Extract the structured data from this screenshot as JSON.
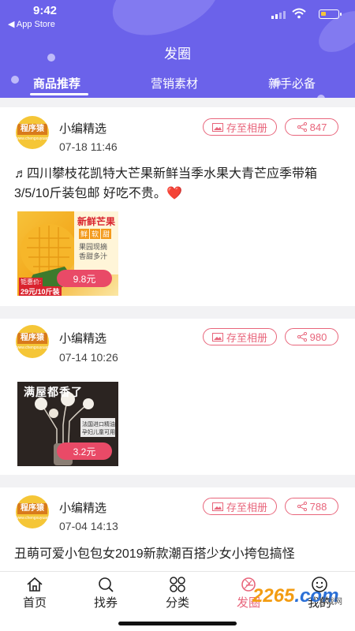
{
  "status_bar": {
    "time": "9:42",
    "back_label": "◀ App Store"
  },
  "header": {
    "title": "发圈",
    "tabs": [
      {
        "label": "商品推荐",
        "active": true
      },
      {
        "label": "营销素材",
        "active": false
      },
      {
        "label": "新手必备",
        "active": false
      }
    ]
  },
  "colors": {
    "header_bg": "#6b62ea",
    "accent": "#e8657b",
    "price_tag": "#e94a67"
  },
  "posts": [
    {
      "avatar_text": "程序猿",
      "avatar_sub": "www.chengxuyuan.com",
      "author": "小编精选",
      "date": "07-18 11:46",
      "save_label": "存至相册",
      "share_count": "847",
      "description": "♬四川攀枝花凯特大芒果新鲜当季水果大青芒应季带箱3/5/10斤装包邮 好吃不贵。",
      "image_texts": [
        "新鲜芒果",
        "鲜",
        "软",
        "甜",
        "果园现摘",
        "香甜多汁",
        "钜惠价:",
        "29元/10斤装"
      ],
      "price": "9.8元"
    },
    {
      "avatar_text": "程序猿",
      "avatar_sub": "www.chengxuyuan.com",
      "author": "小编精选",
      "date": "07-14 10:26",
      "save_label": "存至相册",
      "share_count": "980",
      "description": "",
      "image_texts": [
        "满屋都香了",
        "法国进口精油",
        "孕妇儿童可用"
      ],
      "price": "3.2元"
    },
    {
      "avatar_text": "程序猿",
      "avatar_sub": "www.chengxuyuan.com",
      "author": "小编精选",
      "date": "07-04 14:13",
      "save_label": "存至相册",
      "share_count": "788",
      "description": "丑萌可爱小包包女2019新款潮百搭少女小挎包搞怪"
    }
  ],
  "bottom_nav": [
    {
      "label": "首页",
      "icon": "home-icon",
      "active": false
    },
    {
      "label": "找券",
      "icon": "search-coupon-icon",
      "active": false
    },
    {
      "label": "分类",
      "icon": "category-icon",
      "active": false
    },
    {
      "label": "发圈",
      "icon": "camera-lens-icon",
      "active": true
    },
    {
      "label": "我的",
      "icon": "user-icon",
      "active": false
    }
  ],
  "watermark": {
    "main": "2265",
    "suffix": ".com",
    "small": "游戏网"
  }
}
